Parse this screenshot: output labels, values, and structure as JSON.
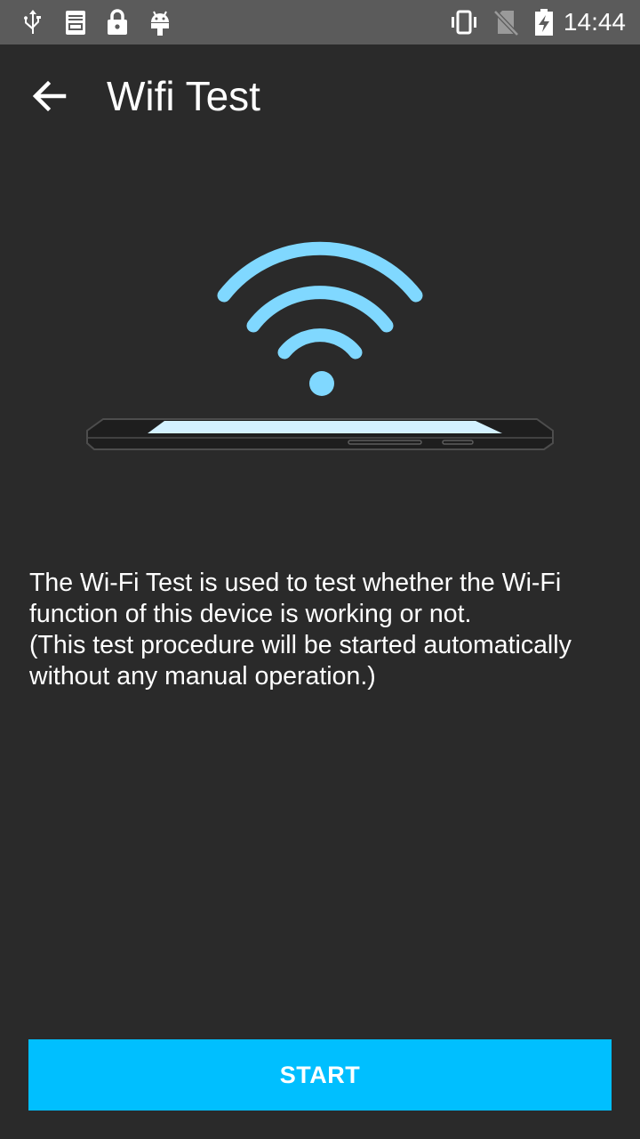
{
  "status_bar": {
    "time": "14:44",
    "left_icons": [
      "usb-icon",
      "log-icon",
      "lock-icon",
      "android-debug-icon"
    ],
    "right_icons": [
      "vibrate-icon",
      "no-sim-icon",
      "battery-charging-icon"
    ]
  },
  "toolbar": {
    "back_icon": "arrow-back-icon",
    "title": "Wifi Test"
  },
  "illustration": {
    "icon": "wifi-phone-icon",
    "accent_color": "#80d8ff"
  },
  "description": {
    "line1": "The Wi-Fi Test is used to test whether the Wi-Fi",
    "line2": "function of this device is working or not.",
    "line3": "(This test procedure will be started automatically",
    "line4": "without any manual operation.)"
  },
  "start_button": {
    "label": "START",
    "color": "#00bfff"
  }
}
